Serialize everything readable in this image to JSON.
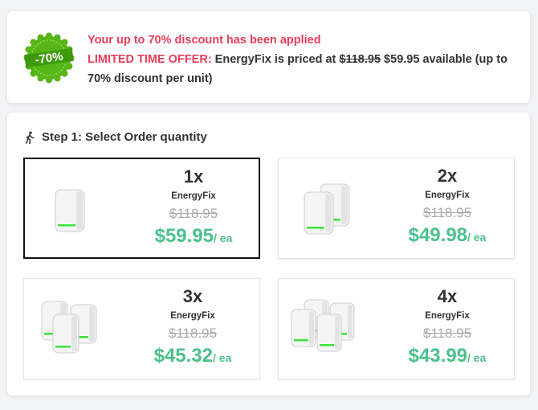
{
  "banner": {
    "badge_text": "-70%",
    "headline": "Your up to 70% discount has been applied",
    "offer_label": "LIMITED TIME OFFER:",
    "offer_text": " EnergyFix is priced at ",
    "old_price": "$118.95",
    "new_price_text": " $59.95 available (up to 70% discount per unit)"
  },
  "step": {
    "title": "Step 1: Select Order quantity"
  },
  "options": [
    {
      "qty": "1x",
      "name": "EnergyFix",
      "old_price": "$118.95",
      "price": "$59.95",
      "per": "/ ea",
      "selected": true
    },
    {
      "qty": "2x",
      "name": "EnergyFix",
      "old_price": "$118.95",
      "price": "$49.98",
      "per": "/ ea",
      "selected": false
    },
    {
      "qty": "3x",
      "name": "EnergyFix",
      "old_price": "$118.95",
      "price": "$45.32",
      "per": "/ ea",
      "selected": false
    },
    {
      "qty": "4x",
      "name": "EnergyFix",
      "old_price": "$118.95",
      "price": "$43.99",
      "per": "/ ea",
      "selected": false
    }
  ],
  "colors": {
    "accent_red": "#e83e5a",
    "price_green": "#4cc18a",
    "badge_green": "#56b517"
  },
  "icons": {
    "badge": "discount-seal-icon",
    "step": "walking-person-icon",
    "product": "energyfix-device-image"
  }
}
